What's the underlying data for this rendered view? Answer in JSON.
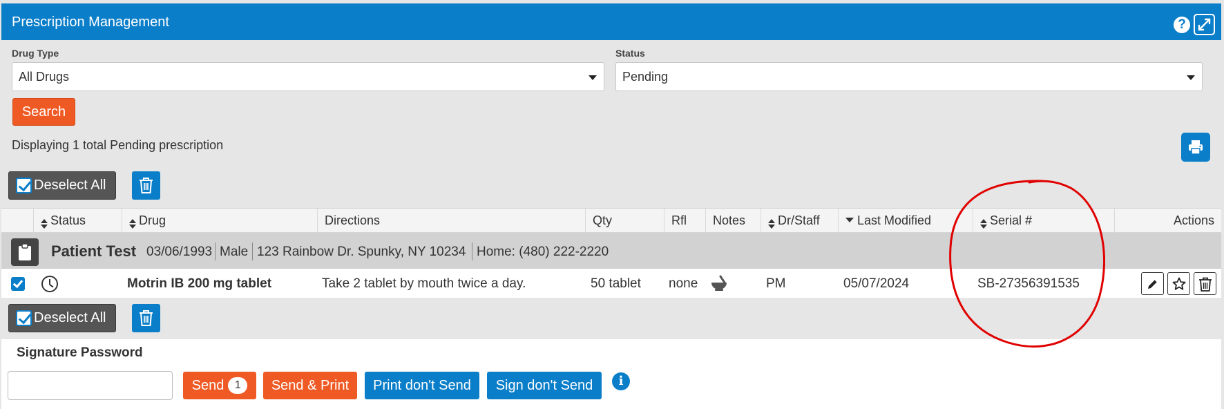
{
  "header": {
    "title": "Prescription Management"
  },
  "filters": {
    "drug_type_label": "Drug Type",
    "drug_type_value": "All Drugs",
    "status_label": "Status",
    "status_value": "Pending",
    "search_label": "Search"
  },
  "summary": "Displaying 1 total Pending prescription",
  "toolbar": {
    "deselect_label": "Deselect All"
  },
  "table": {
    "columns": {
      "status": "Status",
      "drug": "Drug",
      "directions": "Directions",
      "qty": "Qty",
      "rfl": "Rfl",
      "notes": "Notes",
      "dr_staff": "Dr/Staff",
      "last_modified": "Last Modified",
      "serial": "Serial #",
      "actions": "Actions"
    },
    "patient": {
      "name": "Patient Test",
      "dob": "03/06/1993",
      "sex": "Male",
      "address": "123 Rainbow Dr. Spunky, NY 10234",
      "phone": "Home: (480) 222-2220"
    },
    "rows": [
      {
        "drug": "Motrin IB 200 mg tablet",
        "directions": "Take 2 tablet by mouth twice a day.",
        "qty": "50 tablet",
        "rfl": "none",
        "dr_staff": "PM",
        "last_modified": "05/07/2024",
        "serial": "SB-27356391535"
      }
    ]
  },
  "signature": {
    "label": "Signature Password",
    "send_label": "Send",
    "send_count": "1",
    "send_print_label": "Send & Print",
    "print_dont_send_label": "Print don't Send",
    "sign_dont_send_label": "Sign don't Send"
  },
  "colors": {
    "primary": "#0b7ec9",
    "accent": "#ef5a24",
    "annotation": "#e00000"
  }
}
